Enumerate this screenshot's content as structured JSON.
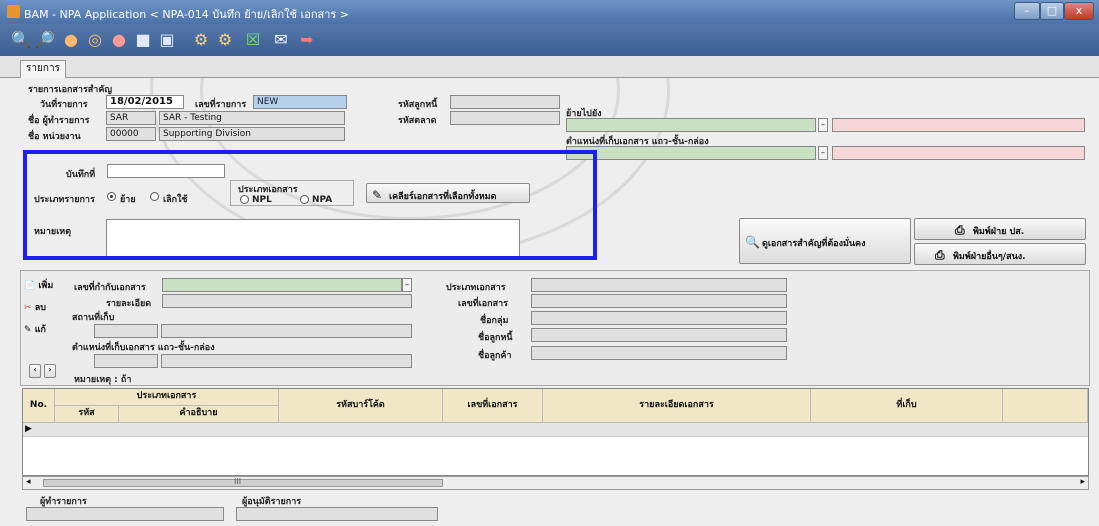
{
  "window": {
    "title": "BAM - NPA Application < NPA-014 บันทึก ย้าย/เลิกใช้ เอกสาร >",
    "min": "–",
    "max": "□",
    "close": "x"
  },
  "toolbar": {
    "icons": [
      "search-icon",
      "zoom-icon",
      "add-icon",
      "edit-icon",
      "delete-icon",
      "save-icon",
      "save-as-icon",
      "tools-icon",
      "cancel-tools-icon",
      "excel-icon",
      "mail-icon",
      "exit-icon"
    ]
  },
  "tabs": [
    {
      "label": "รายการ"
    }
  ],
  "header": {
    "section_title": "รายการเอกสารสำคัญ",
    "date_label": "วันที่รายการ",
    "date_value": "18/02/2015",
    "docno_label": "เลขที่รายการ",
    "docno_value": "NEW",
    "debtor_label": "รหัสลูกหนี้",
    "debtor_value": "",
    "market_label": "รหัสตลาด",
    "market_value": "",
    "maker_label": "ชื่อ ผู้ทำรายการ",
    "maker_code": "SAR",
    "maker_name": "SAR - Testing",
    "dept_label": "ชื่อ หน่วยงาน",
    "dept_code": "00000",
    "dept_name": "Supporting Division",
    "move_to_label": "ย้ายไปยัง",
    "storage_label": "ตำแหน่งที่เก็บเอกสาร แถว-ชั้น-กล่อง",
    "note_label": "บันทึกที่",
    "type_label": "ประเภทรายการ",
    "radio_move": "ย้าย",
    "radio_cancel": "เลิกใช้",
    "doctype_label": "ประเภทเอกสาร",
    "doctype_npl": "NPL",
    "doctype_npa": "NPA",
    "clear_btn": "เคลียร์เอกสารที่เลือกทั้งหมด",
    "remark_label": "หมายเหตุ"
  },
  "actions": {
    "view_docs": "ดูเอกสารสำคัญที่ต้องมั่นคง",
    "print_ps": "พิมพ์ฝ่าย ปส.",
    "print_other": "พิมพ์ฝ่ายอื่นๆ/สนง."
  },
  "detail": {
    "add": "เพิ่ม",
    "del": "ลบ",
    "edit": "แก้",
    "ref_label": "เลขที่กำกับเอกสาร",
    "desc_label": "รายละเอียด",
    "place_label": "สถานที่เก็บ",
    "position_label": "ตำแหน่งที่เก็บเอกสาร แถว-ชั้น-กล่อง",
    "remark_label": "หมายเหตุ : ถ้า",
    "r_doctype": "ประเภทเอกสาร",
    "r_docno": "เลขที่เอกสาร",
    "r_group": "ชื่อกลุ่ม",
    "r_debtor": "ชื่อลูกหนี้",
    "r_borrower": "ชื่อลูกค้า"
  },
  "grid": {
    "no": "No.",
    "doctype": "ประเภทเอกสาร",
    "code": "รหัส",
    "desc": "คำอธิบาย",
    "barcode": "รหัสบาร์โค้ด",
    "docno": "เลขที่เอกสาร",
    "docdetail": "รายละเอียดเอกสาร",
    "store": "ที่เก็บ"
  },
  "footer": {
    "maker": "ผู้ทำรายการ",
    "approver": "ผู้อนุมัติรายการ",
    "scroll": "III"
  }
}
